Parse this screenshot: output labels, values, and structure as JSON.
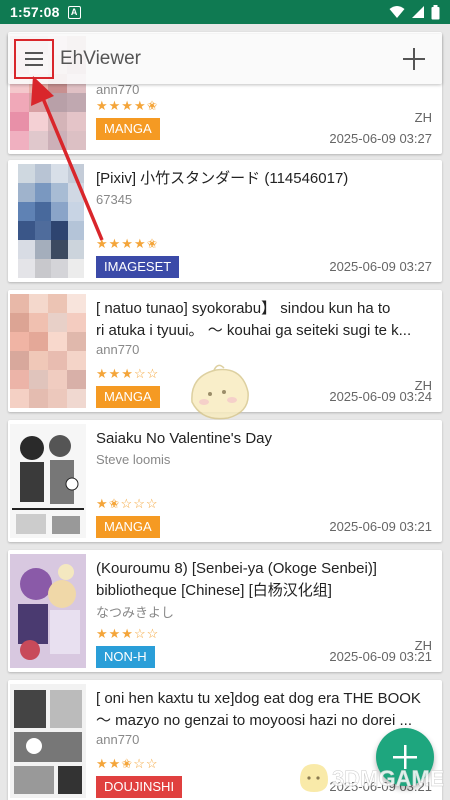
{
  "status": {
    "time": "1:57:08",
    "notif": "A"
  },
  "toolbar": {
    "title": "EhViewer"
  },
  "galleries": [
    {
      "title": "",
      "uploader": "ann770",
      "rating": 4.5,
      "stars": "★★★★✬",
      "category": "MANGA",
      "category_color": "#f59a23",
      "language": "ZH",
      "date": "2025-06-09 03:27"
    },
    {
      "title": "[Pixiv] 小竹スタンダード (114546017)",
      "uploader": "67345",
      "rating": 4.5,
      "stars": "★★★★✬",
      "category": "IMAGESET",
      "category_color": "#3b4aa8",
      "language": "",
      "date": "2025-06-09 03:27"
    },
    {
      "title": "[ natuo tunao] syokorabu】 sindou kun ha to",
      "title2": "ri atuka i tyuui。 ～ kouhai ga seiteki sugi te k...",
      "uploader": "ann770",
      "rating": 3,
      "stars": "★★★☆☆",
      "category": "MANGA",
      "category_color": "#f59a23",
      "language": "ZH",
      "date": "2025-06-09 03:24"
    },
    {
      "title": "Saiaku No Valentine's Day",
      "uploader": "Steve loomis",
      "rating": 1.5,
      "stars": "★✬☆☆☆",
      "category": "MANGA",
      "category_color": "#f59a23",
      "language": "",
      "date": "2025-06-09 03:21"
    },
    {
      "title": "(Kouroumu 8) [Senbei-ya (Okoge Senbei)]",
      "title2": "bibliotheque [Chinese] [白杨汉化组]",
      "uploader": "なつみきよし",
      "rating": 3,
      "stars": "★★★☆☆",
      "category": "NON-H",
      "category_color": "#2a9ed8",
      "language": "ZH",
      "date": "2025-06-09 03:21"
    },
    {
      "title": "[ oni hen kaxtu tu xe]dog eat dog era THE BOOK",
      "title2": "～ mazyo no genzai to moyoosi hazi no dorei ...",
      "uploader": "ann770",
      "rating": 2.5,
      "stars": "★★✬☆☆",
      "category": "DOUJINSHI",
      "category_color": "#e0403f",
      "language": "",
      "date": "2025-06-09 03:21"
    }
  ],
  "watermark": "3DMGAME",
  "colors": {
    "status_bar": "#0f7a52",
    "fab": "#1ea67e",
    "highlight": "#d9262b",
    "star": "#f4a53a"
  }
}
